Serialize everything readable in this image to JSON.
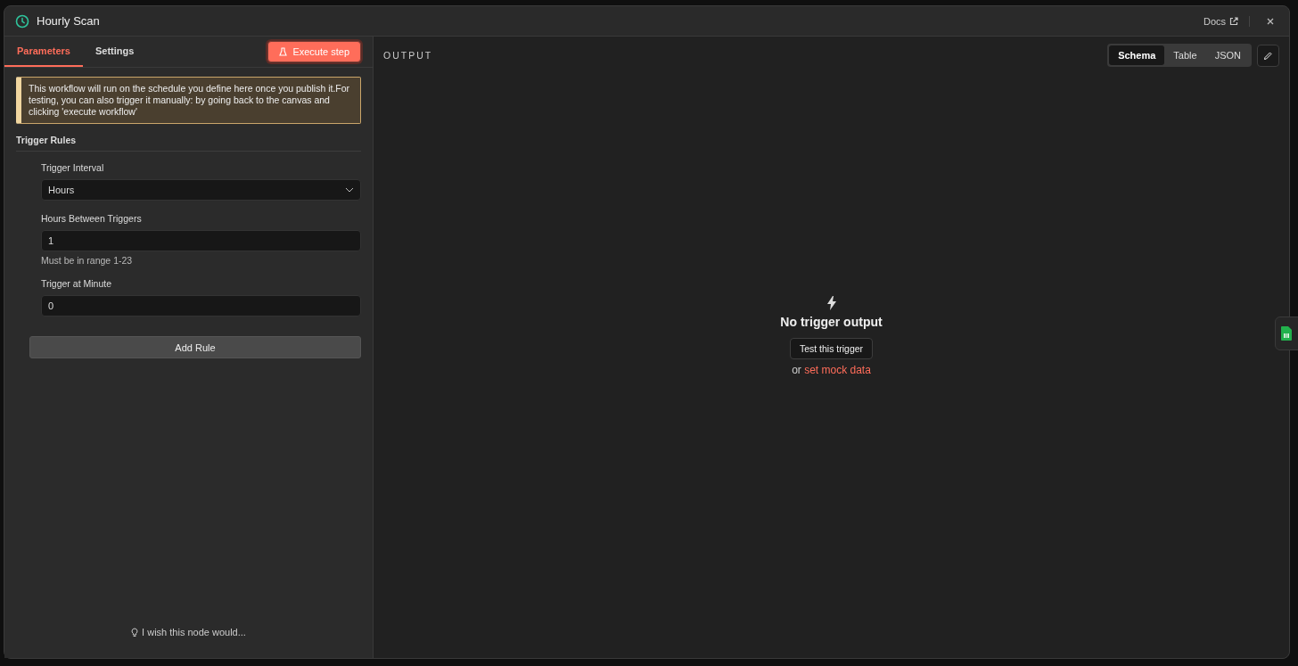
{
  "window": {
    "title": "Hourly Scan",
    "docs_link": "Docs"
  },
  "tabs": [
    {
      "label": "Parameters",
      "selected": true
    },
    {
      "label": "Settings",
      "selected": false
    }
  ],
  "execute_button": "Execute step",
  "notice": "This workflow will run on the schedule you define here once you publish it.For testing, you can also trigger it manually: by going back to the canvas and clicking 'execute workflow'",
  "section_title": "Trigger Rules",
  "fields": [
    {
      "kind": "select",
      "label": "Trigger Interval",
      "value": "Hours"
    },
    {
      "kind": "input",
      "label": "Hours Between Triggers",
      "value": "1",
      "hint": "Must be in range 1-23"
    },
    {
      "kind": "input",
      "label": "Trigger at Minute",
      "value": "0"
    }
  ],
  "add_button": "Add Rule",
  "feedback": "I wish this node would...",
  "output": {
    "title": "OUTPUT",
    "views": [
      {
        "label": "Schema",
        "selected": true
      },
      {
        "label": "Table",
        "selected": false
      },
      {
        "label": "JSON",
        "selected": false
      }
    ],
    "empty_title": "No trigger output",
    "test_button": "Test this trigger",
    "or_text": "or",
    "mock_link": "set mock data"
  }
}
